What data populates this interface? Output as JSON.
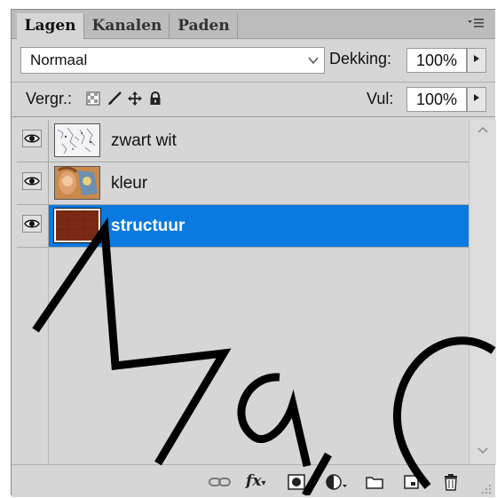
{
  "tabs": [
    {
      "label": "Lagen",
      "active": true
    },
    {
      "label": "Kanalen",
      "active": false
    },
    {
      "label": "Paden",
      "active": false
    }
  ],
  "panel_menu_icon": "panel-menu-icon",
  "blend_mode": {
    "value": "Normaal"
  },
  "opacity": {
    "label": "Dekking:",
    "value": "100%"
  },
  "lock": {
    "label": "Vergr.:",
    "icons": [
      "lock-transparent-icon",
      "lock-image-icon",
      "lock-position-icon",
      "lock-all-icon"
    ]
  },
  "fill": {
    "label": "Vul:",
    "value": "100%"
  },
  "layers": [
    {
      "name": "zwart wit",
      "visible": true,
      "selected": false
    },
    {
      "name": "kleur",
      "visible": true,
      "selected": false
    },
    {
      "name": "structuur",
      "visible": true,
      "selected": true
    }
  ],
  "bottom_icons": [
    "link-layers-icon",
    "fx-icon",
    "layer-mask-icon",
    "adjustment-layer-icon",
    "new-group-icon",
    "new-layer-icon",
    "trash-icon"
  ],
  "fx_label": "fx",
  "watermark": {
    "text": "Maija C",
    "color": "#000000"
  },
  "colors": {
    "selection": "#0a79e0",
    "panel": "#d6d6d6",
    "tabbar": "#bcbcbc"
  }
}
